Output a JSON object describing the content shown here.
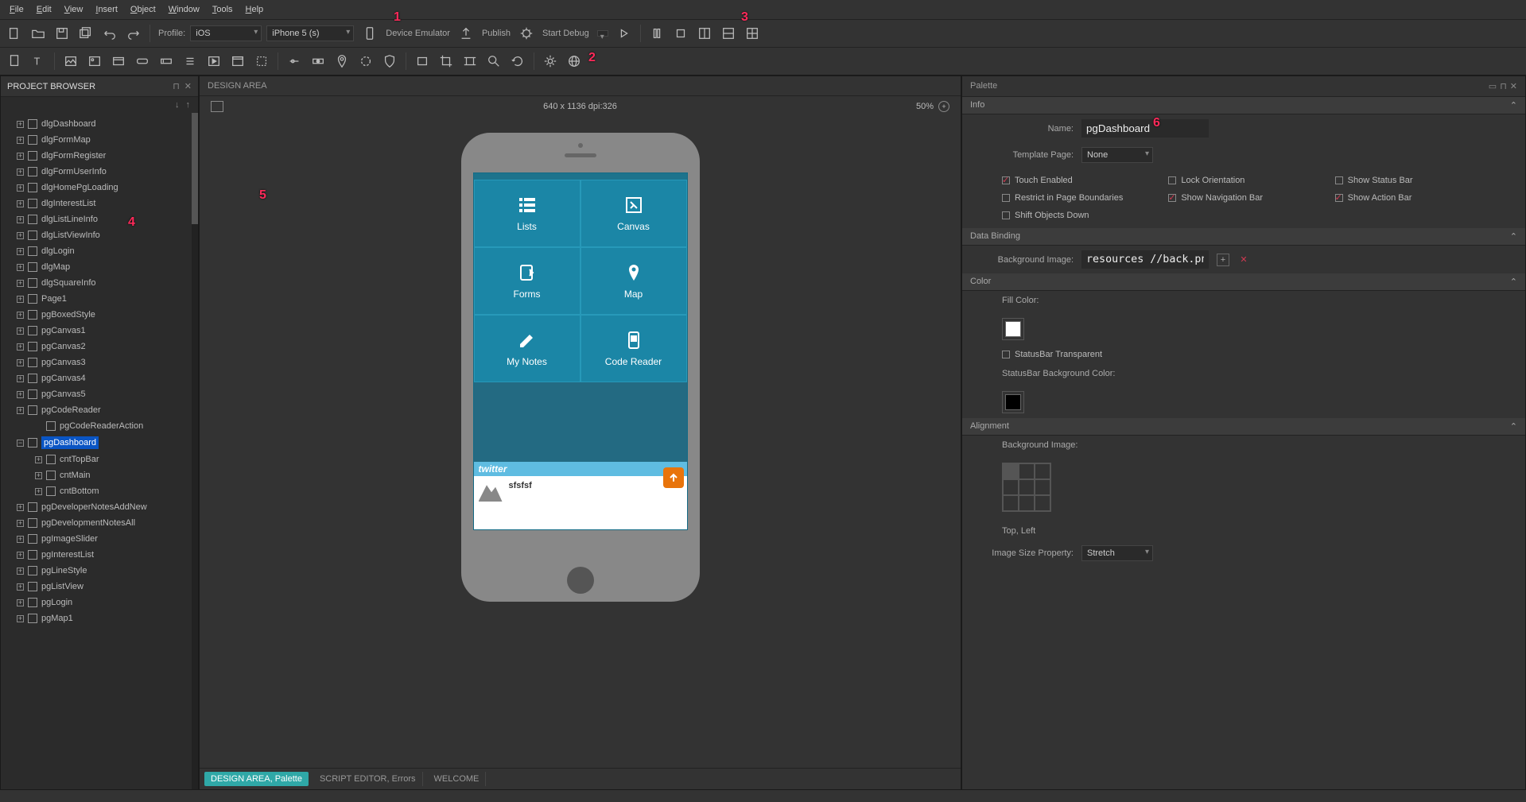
{
  "menu": {
    "file": "File",
    "edit": "Edit",
    "view": "View",
    "insert": "Insert",
    "object": "Object",
    "window": "Window",
    "tools": "Tools",
    "help": "Help"
  },
  "toolbar": {
    "profile_label": "Profile:",
    "profile_value": "iOS",
    "device_value": "iPhone 5 (s)",
    "device_emulator": "Device Emulator",
    "publish": "Publish",
    "start_debug": "Start Debug"
  },
  "project_browser": {
    "title": "PROJECT BROWSER",
    "items": [
      {
        "label": "dlgDashboard",
        "level": 1
      },
      {
        "label": "dlgFormMap",
        "level": 1
      },
      {
        "label": "dlgFormRegister",
        "level": 1
      },
      {
        "label": "dlgFormUserInfo",
        "level": 1
      },
      {
        "label": "dlgHomePgLoading",
        "level": 1
      },
      {
        "label": "dlgInterestList",
        "level": 1
      },
      {
        "label": "dlgListLineInfo",
        "level": 1
      },
      {
        "label": "dlgListViewInfo",
        "level": 1
      },
      {
        "label": "dlgLogin",
        "level": 1
      },
      {
        "label": "dlgMap",
        "level": 1
      },
      {
        "label": "dlgSquareInfo",
        "level": 1
      },
      {
        "label": "Page1",
        "level": 1
      },
      {
        "label": "pgBoxedStyle",
        "level": 1
      },
      {
        "label": "pgCanvas1",
        "level": 1
      },
      {
        "label": "pgCanvas2",
        "level": 1
      },
      {
        "label": "pgCanvas3",
        "level": 1
      },
      {
        "label": "pgCanvas4",
        "level": 1
      },
      {
        "label": "pgCanvas5",
        "level": 1
      },
      {
        "label": "pgCodeReader",
        "level": 1
      },
      {
        "label": "pgCodeReaderAction",
        "level": 2,
        "no_expander": true
      },
      {
        "label": "pgDashboard",
        "level": 1,
        "selected": true,
        "expanded": true
      },
      {
        "label": "cntTopBar",
        "level": 2
      },
      {
        "label": "cntMain",
        "level": 2
      },
      {
        "label": "cntBottom",
        "level": 2
      },
      {
        "label": "pgDeveloperNotesAddNew",
        "level": 1
      },
      {
        "label": "pgDevelopmentNotesAll",
        "level": 1
      },
      {
        "label": "pgImageSlider",
        "level": 1
      },
      {
        "label": "pgInterestList",
        "level": 1
      },
      {
        "label": "pgLineStyle",
        "level": 1
      },
      {
        "label": "pgListView",
        "level": 1
      },
      {
        "label": "pgLogin",
        "level": 1
      },
      {
        "label": "pgMap1",
        "level": 1
      }
    ]
  },
  "design_area": {
    "title": "DESIGN AREA",
    "dimensions": "640 x 1136 dpi:326",
    "zoom": "50%",
    "grid": [
      [
        "Lists",
        "Canvas"
      ],
      [
        "Forms",
        "Map"
      ],
      [
        "My Notes",
        "Code Reader"
      ]
    ],
    "twitter_label": "twitter",
    "bottom_text": "sfsfsf",
    "tabs": [
      {
        "label": "DESIGN AREA, Palette",
        "active": true
      },
      {
        "label": "SCRIPT EDITOR, Errors",
        "active": false
      },
      {
        "label": "WELCOME",
        "active": false
      }
    ]
  },
  "palette": {
    "title": "Palette",
    "info_tab": "Info",
    "name_label": "Name:",
    "name_value": "pgDashboard",
    "template_label": "Template Page:",
    "template_value": "None",
    "checkboxes": {
      "touch_enabled": {
        "label": "Touch Enabled",
        "checked": true
      },
      "lock_orientation": {
        "label": "Lock Orientation",
        "checked": false
      },
      "show_status_bar": {
        "label": "Show Status Bar",
        "checked": false
      },
      "restrict_boundaries": {
        "label": "Restrict in Page Boundaries",
        "checked": false
      },
      "show_navigation_bar": {
        "label": "Show Navigation Bar",
        "checked": true
      },
      "show_action_bar": {
        "label": "Show Action Bar",
        "checked": true
      },
      "shift_objects_down": {
        "label": "Shift Objects Down",
        "checked": false
      }
    },
    "data_binding_section": "Data Binding",
    "bg_image_label": "Background Image:",
    "bg_image_value": "resources //back.png",
    "color_section": "Color",
    "fill_color_label": "Fill Color:",
    "statusbar_transparent": "StatusBar Transparent",
    "statusbar_bg_label": "StatusBar Background Color:",
    "alignment_section": "Alignment",
    "alignment_bg_label": "Background Image:",
    "alignment_pos": "Top, Left",
    "image_size_label": "Image Size Property:",
    "image_size_value": "Stretch"
  },
  "callouts": {
    "c1": "1",
    "c2": "2",
    "c3": "3",
    "c4": "4",
    "c5": "5",
    "c6": "6"
  }
}
